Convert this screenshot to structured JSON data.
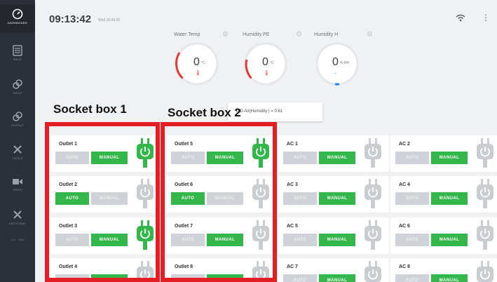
{
  "sidebar": {
    "items": [
      {
        "label": "DASHBOARD",
        "icon": "dashboard-gauge-icon",
        "active": true
      },
      {
        "label": "RACK",
        "icon": "rack-icon"
      },
      {
        "label": "INPUT",
        "icon": "input-link-icon"
      },
      {
        "label": "OUTPUT",
        "icon": "output-link-icon"
      },
      {
        "label": "TOOLS",
        "icon": "tools-icon"
      },
      {
        "label": "VIDEO",
        "icon": "video-camera-icon"
      },
      {
        "label": "ASSISTANT",
        "icon": "assistant-tools-icon"
      }
    ],
    "version": "v1.0 · Beta"
  },
  "header": {
    "time": "09:13:42",
    "date": "Wed 16.09.20"
  },
  "gauges": [
    {
      "title": "Water Temp",
      "value": "0",
      "unit": "°C",
      "icon": "thermometer-icon",
      "icon_color": "#e53935",
      "arc_color": "#e53935"
    },
    {
      "title": "Humidity PE",
      "value": "0",
      "unit": "°C",
      "icon": "thermometer-icon",
      "icon_color": "#e53935",
      "arc_color": "#e53935"
    },
    {
      "title": "Humidity H",
      "value": "0",
      "unit": "% RH",
      "icon": "droplet-icon",
      "icon_color": "#1e88e5",
      "arc_color": "#1e88e5"
    }
  ],
  "tooltip": "PID Air(Humidity ) = 0.61",
  "annotations": {
    "socket_box_1": "Socket box 1",
    "socket_box_2": "Socket box 2"
  },
  "buttons": {
    "auto": "AUTO",
    "manual": "MANUAL"
  },
  "colors": {
    "active_green": "#33b64a",
    "inactive_grey": "#cfd2d6",
    "highlight_red": "#e31e24",
    "sidebar_bg": "#2c3038"
  },
  "outlet_columns": [
    [
      {
        "name": "Outlet 1",
        "mode": "manual",
        "plug": "on"
      },
      {
        "name": "Outlet 2",
        "mode": "auto",
        "plug": "off"
      },
      {
        "name": "Outlet 3",
        "mode": "manual",
        "plug": "on"
      },
      {
        "name": "Outlet 4",
        "mode": "manual",
        "plug": "off"
      }
    ],
    [
      {
        "name": "Outlet 5",
        "mode": "manual",
        "plug": "on"
      },
      {
        "name": "Outlet 6",
        "mode": "auto",
        "plug": "off"
      },
      {
        "name": "Outlet 7",
        "mode": "manual",
        "plug": "off"
      },
      {
        "name": "Outlet 8",
        "mode": "manual",
        "plug": "off"
      }
    ],
    [
      {
        "name": "AC 1",
        "mode": "manual",
        "plug": "off"
      },
      {
        "name": "AC 3",
        "mode": "manual",
        "plug": "off"
      },
      {
        "name": "AC 5",
        "mode": "manual",
        "plug": "off"
      },
      {
        "name": "AC 7",
        "mode": "manual",
        "plug": "off"
      }
    ],
    [
      {
        "name": "AC 2",
        "mode": "manual",
        "plug": "off"
      },
      {
        "name": "AC 4",
        "mode": "manual",
        "plug": "off"
      },
      {
        "name": "AC 6",
        "mode": "manual",
        "plug": "off"
      },
      {
        "name": "AC 8",
        "mode": "manual",
        "plug": "off"
      }
    ]
  ]
}
